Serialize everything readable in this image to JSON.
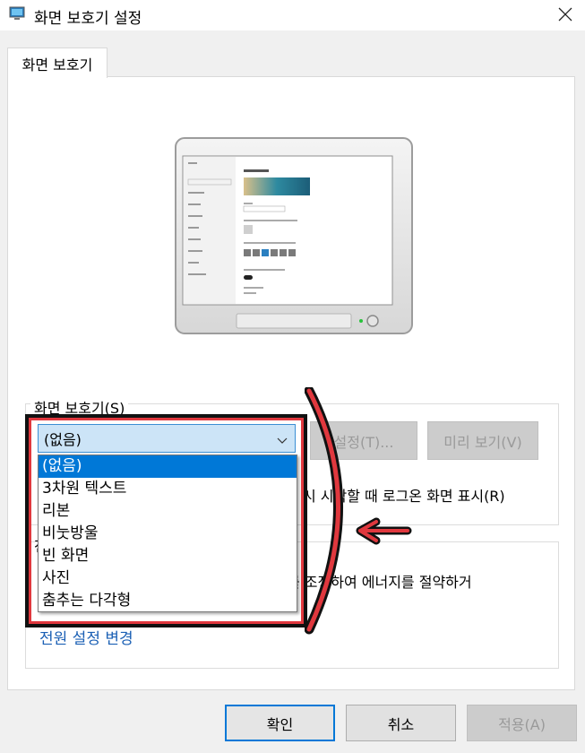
{
  "window": {
    "title": "화면 보호기 설정",
    "close_icon": "close-icon",
    "app_icon": "screensaver-app-icon"
  },
  "tabs": [
    {
      "label": "화면 보호기",
      "selected": true
    }
  ],
  "screensaver_group": {
    "label": "화면 보호기(S)",
    "dropdown": {
      "selected": "(없음)",
      "options": [
        "(없음)",
        "3차원 텍스트",
        "리본",
        "비눗방울",
        "빈 화면",
        "사진",
        "춤추는 다각형"
      ],
      "highlighted": "(없음)"
    },
    "settings_button": "설정(T)...",
    "preview_button": "미리 보기(V)",
    "resume_text": "시 시작할 때 로그온 화면 표시(R)"
  },
  "power_group": {
    "partial_label": "전",
    "description_fragment": "를 조정하여 에너지를 절약하거",
    "link": "전원 설정 변경"
  },
  "buttons": {
    "ok": "확인",
    "cancel": "취소",
    "apply": "적용(A)"
  },
  "annotation": {
    "box_color": "#e0383e",
    "arrow_color": "#e0383e"
  }
}
